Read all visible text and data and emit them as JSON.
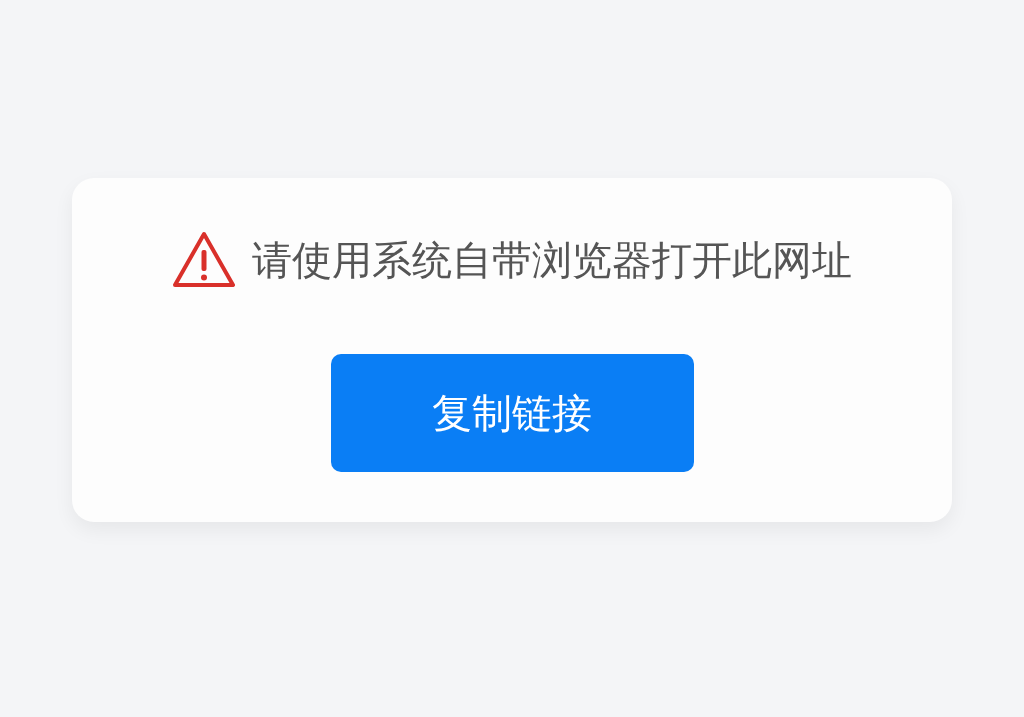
{
  "notice": {
    "message": "请使用系统自带浏览器打开此网址"
  },
  "button": {
    "label": "复制链接"
  }
}
